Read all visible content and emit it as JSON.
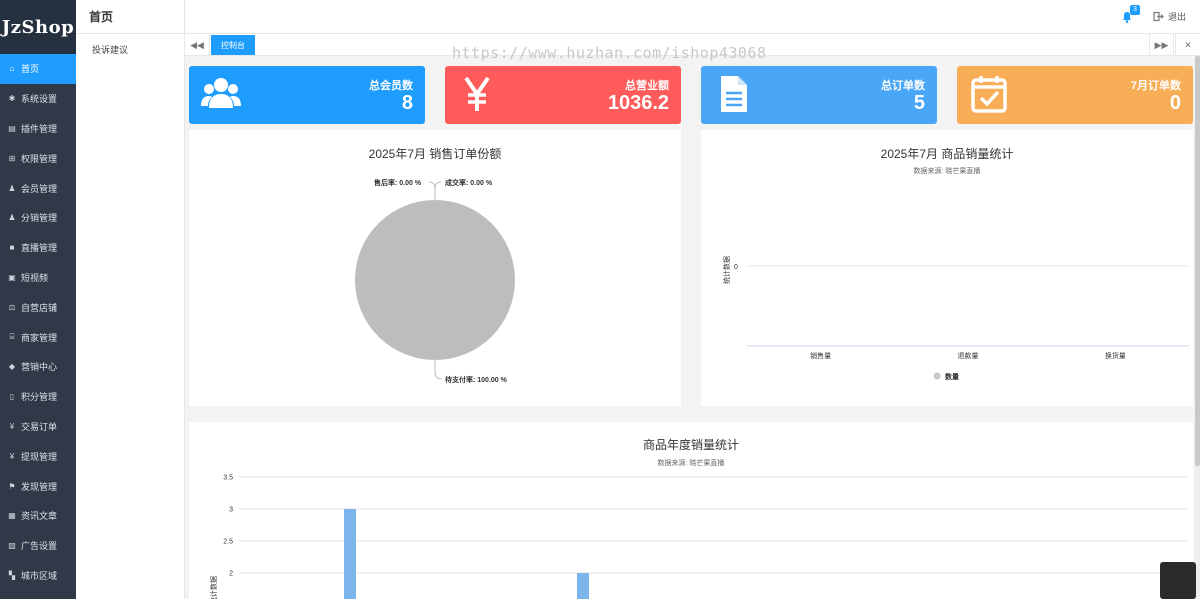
{
  "brand": {
    "logo": "JzShop"
  },
  "sidebar": {
    "items": [
      {
        "label": "首页",
        "icon": "home-icon",
        "glyph": "⌂",
        "active": true
      },
      {
        "label": "系统设置",
        "icon": "gear-icon",
        "glyph": "✱"
      },
      {
        "label": "插件管理",
        "icon": "plugin-icon",
        "glyph": "▤"
      },
      {
        "label": "权限管理",
        "icon": "sitemap-icon",
        "glyph": "⊞"
      },
      {
        "label": "会员管理",
        "icon": "users-icon",
        "glyph": "♟"
      },
      {
        "label": "分销管理",
        "icon": "users-icon",
        "glyph": "♟"
      },
      {
        "label": "直播管理",
        "icon": "video-icon",
        "glyph": "■"
      },
      {
        "label": "短视频",
        "icon": "file-video-icon",
        "glyph": "▣"
      },
      {
        "label": "自营店铺",
        "icon": "balance-icon",
        "glyph": "⚖"
      },
      {
        "label": "商家管理",
        "icon": "bank-icon",
        "glyph": "⌸"
      },
      {
        "label": "营销中心",
        "icon": "tag-icon",
        "glyph": "◆"
      },
      {
        "label": "积分管理",
        "icon": "file-icon",
        "glyph": "▯"
      },
      {
        "label": "交易订单",
        "icon": "yen-icon",
        "glyph": "¥"
      },
      {
        "label": "提现管理",
        "icon": "yen-icon",
        "glyph": "¥"
      },
      {
        "label": "发现管理",
        "icon": "flag-icon",
        "glyph": "⚑"
      },
      {
        "label": "资讯文章",
        "icon": "newspaper-icon",
        "glyph": "▦"
      },
      {
        "label": "广告设置",
        "icon": "image-icon",
        "glyph": "▨"
      },
      {
        "label": "城市区域",
        "icon": "map-icon",
        "glyph": "▚"
      }
    ]
  },
  "subnav": {
    "title": "首页",
    "item": "投诉建议"
  },
  "header": {
    "notify_count": "3",
    "logout": "退出"
  },
  "tabs": {
    "active": "控制台",
    "prev_glyph": "◀◀",
    "next_glyph": "▶▶",
    "close_glyph": "✕"
  },
  "watermark": "https://www.huzhan.com/ishop43068",
  "stats": [
    {
      "label": "总会员数",
      "value": "8",
      "color": "#1e9dff",
      "icon": "users-icon"
    },
    {
      "label": "总营业额",
      "value": "1036.2",
      "color": "#ff5b5b",
      "icon": "yen-icon"
    },
    {
      "label": "总订单数",
      "value": "5",
      "color": "#4aa6f7",
      "icon": "document-icon"
    },
    {
      "label": "7月订单数",
      "value": "0",
      "color": "#f8ad57",
      "icon": "calendar-check-icon"
    }
  ],
  "pie_panel": {
    "title": "2025年7月 销售订单份额"
  },
  "bar_panel": {
    "title": "2025年7月 商品销量统计",
    "subtitle": "数据来源: 晓芒果直播"
  },
  "annual_panel": {
    "title": "商品年度销量统计",
    "subtitle": "数据来源: 晓芒果直播"
  },
  "chart_data": [
    {
      "type": "pie",
      "title": "2025年7月 销售订单份额",
      "slices": [
        {
          "label": "售后率: 0.00 %",
          "value": 0
        },
        {
          "label": "成交率: 0.00 %",
          "value": 0
        },
        {
          "label": "待支付率: 100.00 %",
          "value": 100
        }
      ],
      "colors": [
        "#bdbdbd"
      ]
    },
    {
      "type": "bar",
      "title": "2025年7月 商品销量统计",
      "subtitle": "数据来源: 晓芒果直播",
      "categories": [
        "销售量",
        "退款量",
        "换货量"
      ],
      "series": [
        {
          "name": "数量",
          "values": [
            0,
            0,
            0
          ]
        }
      ],
      "ylabel": "统计数据",
      "yticks": [
        "0"
      ],
      "legend": "bottom"
    },
    {
      "type": "bar",
      "title": "商品年度销量统计",
      "subtitle": "数据来源: 晓芒果直播",
      "ylabel": "统计数据",
      "yticks": [
        "3.5",
        "3",
        "2.5",
        "2"
      ],
      "ylim": [
        0,
        3.5
      ],
      "values": [
        3,
        2
      ],
      "color": "#7cb5ec"
    }
  ]
}
